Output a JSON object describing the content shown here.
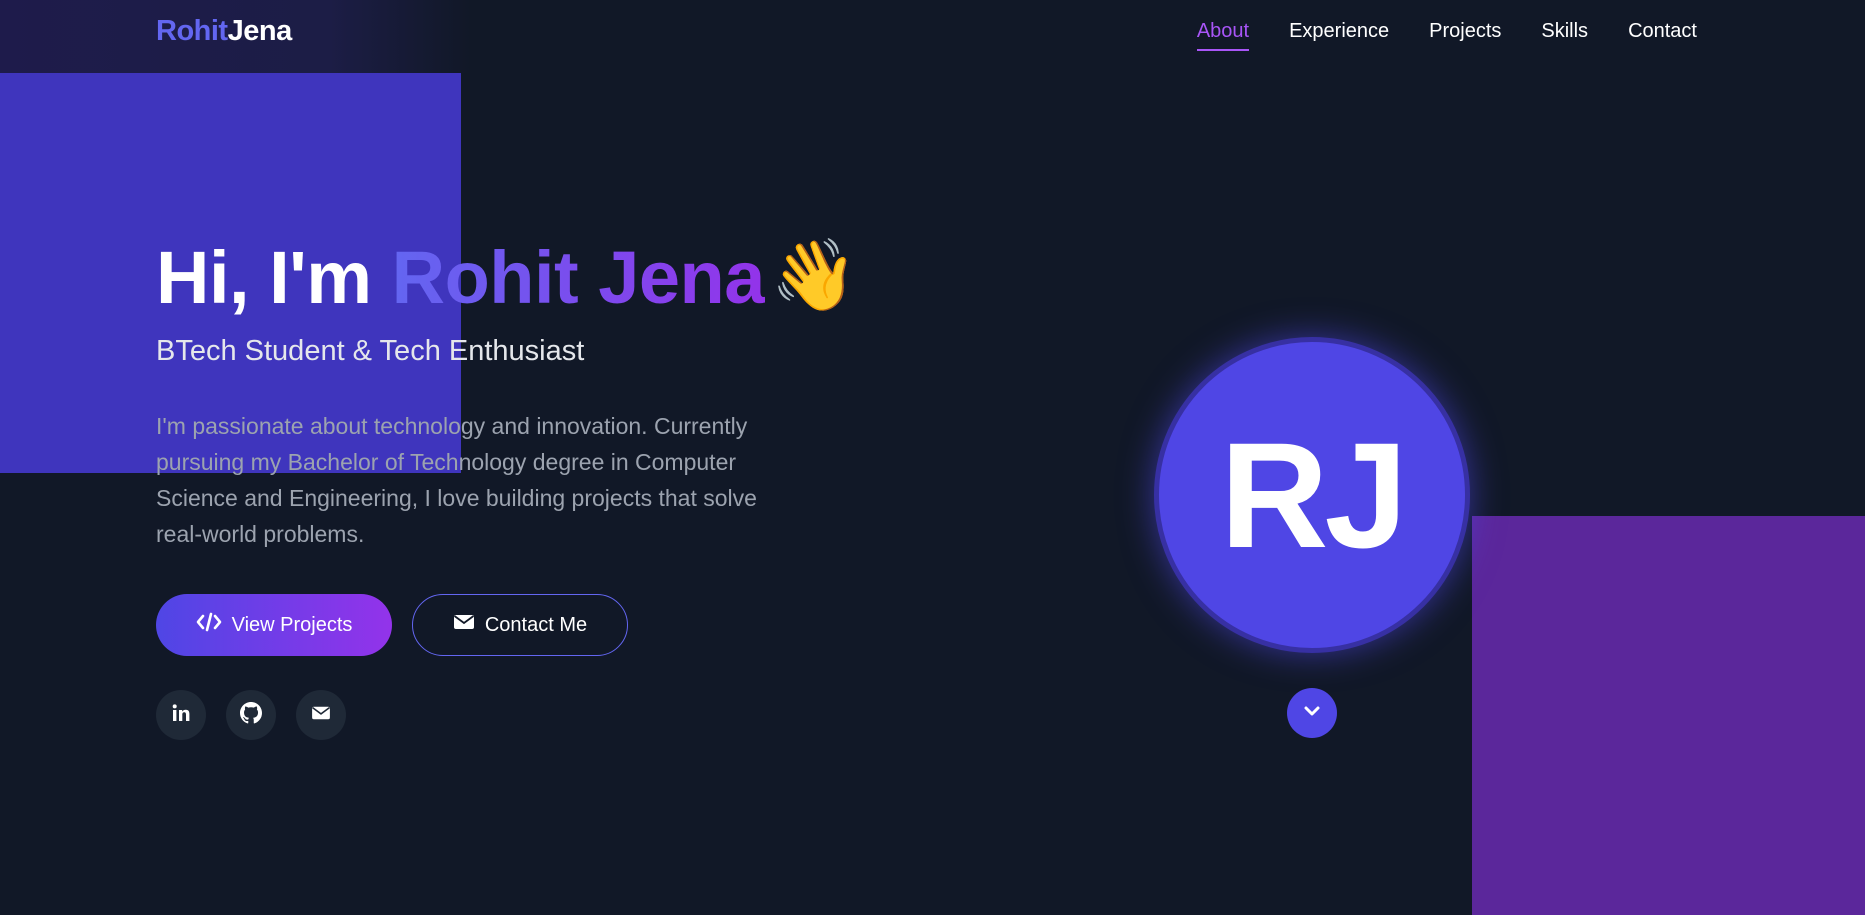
{
  "nav": {
    "logo_first": "Rohit",
    "logo_last": "Jena",
    "links": [
      {
        "label": "About",
        "active": true
      },
      {
        "label": "Experience",
        "active": false
      },
      {
        "label": "Projects",
        "active": false
      },
      {
        "label": "Skills",
        "active": false
      },
      {
        "label": "Contact",
        "active": false
      }
    ]
  },
  "hero": {
    "greeting": "Hi, I'm ",
    "name": "Rohit Jena",
    "wave_emoji": "👋",
    "subtitle": "BTech Student & Tech Enthusiast",
    "description": "I'm passionate about technology and innovation. Currently pursuing my Bachelor of Technology degree in Computer Science and Engineering, I love building projects that solve real-world problems.",
    "primary_button": {
      "label": "View Projects",
      "icon": "code-icon"
    },
    "secondary_button": {
      "label": "Contact Me",
      "icon": "envelope-icon"
    },
    "socials": [
      {
        "icon": "linkedin-icon"
      },
      {
        "icon": "github-icon"
      },
      {
        "icon": "envelope-icon"
      }
    ]
  },
  "avatar": {
    "initials": "RJ"
  },
  "scroll": {
    "icon": "chevron-down-icon"
  },
  "colors": {
    "background": "#111827",
    "accent_indigo": "#6366f1",
    "accent_purple": "#9333ea",
    "active_link": "#a855f7",
    "deco_left": "#4338ca",
    "deco_right": "#5b279b"
  }
}
